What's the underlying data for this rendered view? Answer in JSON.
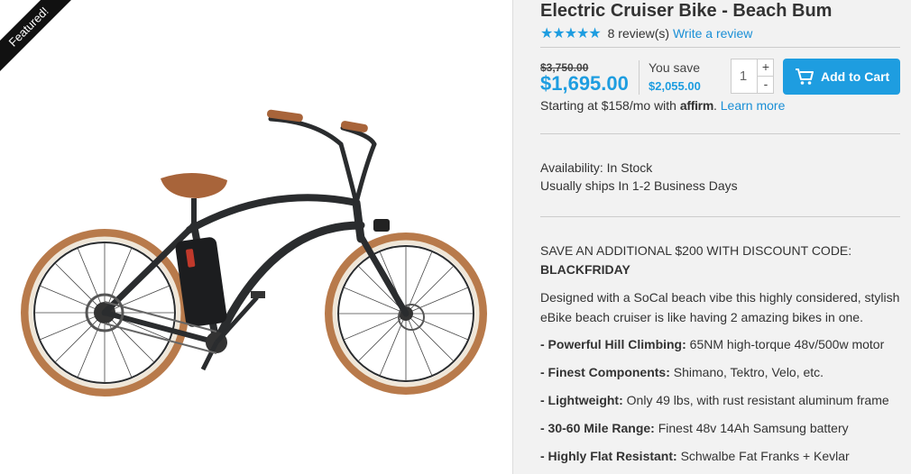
{
  "product": {
    "badge": "Featured!",
    "title": "Electric Cruiser Bike - Beach Bum",
    "rating": 4.5,
    "stars": "★★★★★",
    "reviews_text": "8 review(s)",
    "write_review": "Write a review"
  },
  "pricing": {
    "old_price": "$3,750.00",
    "price": "$1,695.00",
    "you_save_label": "You save",
    "save_amount": "$2,055.00"
  },
  "purchase": {
    "quantity": "1",
    "plus": "+",
    "minus": "-",
    "add_to_cart": "Add to Cart"
  },
  "financing": {
    "prefix": "Starting at $158/mo with",
    "brand": "affirm",
    "dot": ".",
    "learn_more": "Learn more"
  },
  "availability": {
    "status": "Availability: In Stock",
    "shipping": "Usually ships In 1-2 Business Days"
  },
  "promo": {
    "line": "SAVE AN ADDITIONAL $200 WITH DISCOUNT CODE:",
    "code": "BLACKFRIDAY"
  },
  "description": "Designed with a SoCal beach vibe this highly considered, stylish eBike beach cruiser is like having 2 amazing bikes in one.",
  "features": [
    {
      "label": "- Powerful Hill Climbing:",
      "text": " 65NM high-torque 48v/500w motor"
    },
    {
      "label": "- Finest Components:",
      "text": " Shimano, Tektro, Velo, etc."
    },
    {
      "label": "- Lightweight:",
      "text": " Only 49 lbs, with rust resistant aluminum frame"
    },
    {
      "label": "- 30-60 Mile Range:",
      "text": " Finest 48v 14Ah Samsung battery"
    },
    {
      "label": "- Highly Flat Resistant:",
      "text": " Schwalbe Fat Franks + Kevlar"
    }
  ],
  "colors": {
    "accent": "#1e9de0",
    "tire": "#b87a4b",
    "frame": "#2a2c2e",
    "saddle": "#a8643a"
  },
  "icons": {
    "cart": "shopping-cart-icon"
  }
}
